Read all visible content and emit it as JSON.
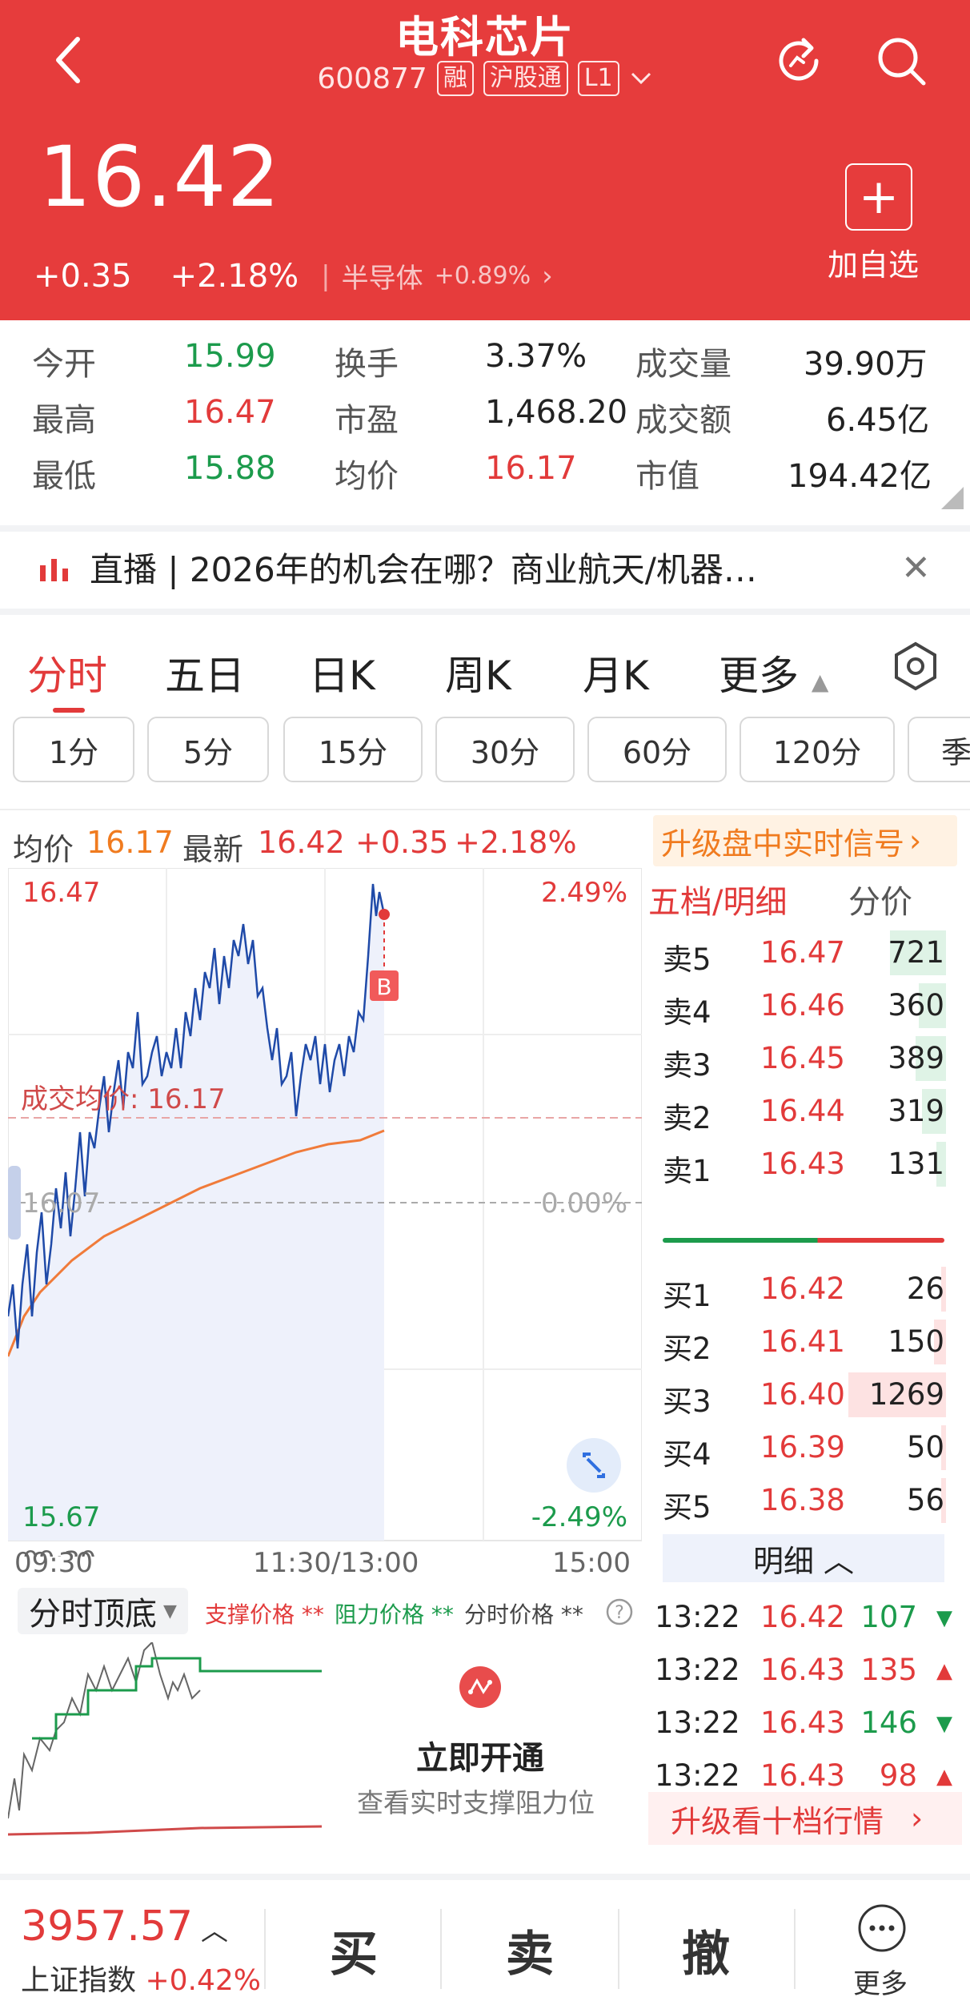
{
  "header": {
    "stock_name": "电科芯片",
    "code": "600877",
    "tags": [
      "融",
      "沪股通",
      "L1"
    ],
    "price": "16.42",
    "change": "+0.35",
    "change_pct": "+2.18%",
    "sector_name": "半导体",
    "sector_pct": "+0.89%",
    "add_label": "加自选"
  },
  "stats": {
    "today_open_label": "今开",
    "today_open": "15.99",
    "high_label": "最高",
    "high": "16.47",
    "low_label": "最低",
    "low": "15.88",
    "turnover_label": "换手",
    "turnover": "3.37%",
    "pe_label": "市盈",
    "pe": "1,468.20",
    "avg_label": "均价",
    "avg": "16.17",
    "volume_label": "成交量",
    "volume": "39.90万",
    "amount_label": "成交额",
    "amount": "6.45亿",
    "mktcap_label": "市值",
    "mktcap": "194.42亿"
  },
  "news": {
    "text": "直播 | 2026年的机会在哪？商业航天/机器…"
  },
  "tabs": [
    "分时",
    "五日",
    "日K",
    "周K",
    "月K",
    "更多"
  ],
  "periods": [
    "1分",
    "5分",
    "15分",
    "30分",
    "60分",
    "120分",
    "季"
  ],
  "infoline": {
    "avg_label": "均价",
    "avg": "16.17",
    "latest_label": "最新",
    "latest": "16.42",
    "chg": "+0.35",
    "pct": "+2.18%",
    "upgrade": "升级盘中实时信号"
  },
  "chart": {
    "y_top": "16.47",
    "y_mid": "16.07",
    "y_bottom": "15.67",
    "pct_top": "2.49%",
    "pct_mid": "0.00%",
    "pct_bottom": "-2.49%",
    "avg_line_label": "成交均价: 16.17",
    "marker": "B",
    "x_start": "09:30",
    "x_mid": "11:30/13:00",
    "x_end": "15:00",
    "colors": {
      "price": "#1f4aa8",
      "avg": "#f07b3a",
      "up": "#e23a3a",
      "down": "#1c9b4c"
    }
  },
  "book": {
    "title": "五档/明细",
    "title_right": "分价",
    "sells": [
      {
        "label": "卖5",
        "price": "16.47",
        "qty": "721",
        "frac": 0.57
      },
      {
        "label": "卖4",
        "price": "16.46",
        "qty": "360",
        "frac": 0.28
      },
      {
        "label": "卖3",
        "price": "16.45",
        "qty": "389",
        "frac": 0.31
      },
      {
        "label": "卖2",
        "price": "16.44",
        "qty": "319",
        "frac": 0.25
      },
      {
        "label": "卖1",
        "price": "16.43",
        "qty": "131",
        "frac": 0.1
      }
    ],
    "buys": [
      {
        "label": "买1",
        "price": "16.42",
        "qty": "26",
        "frac": 0.02
      },
      {
        "label": "买2",
        "price": "16.41",
        "qty": "150",
        "frac": 0.12
      },
      {
        "label": "买3",
        "price": "16.40",
        "qty": "1269",
        "frac": 1.0
      },
      {
        "label": "买4",
        "price": "16.39",
        "qty": "50",
        "frac": 0.04
      },
      {
        "label": "买5",
        "price": "16.38",
        "qty": "56",
        "frac": 0.04
      }
    ],
    "detail_label": "明细",
    "ticks": [
      {
        "time": "13:22",
        "price": "16.42",
        "vol": "107",
        "dir": "down"
      },
      {
        "time": "13:22",
        "price": "16.43",
        "vol": "135",
        "dir": "up"
      },
      {
        "time": "13:22",
        "price": "16.43",
        "vol": "146",
        "dir": "down"
      },
      {
        "time": "13:22",
        "price": "16.43",
        "vol": "98",
        "dir": "up"
      }
    ],
    "upgrade10": "升级看十档行情"
  },
  "indicator": {
    "select": "分时顶底",
    "legend_support": "支撑价格 **",
    "legend_resist": "阻力价格 **",
    "legend_time": "分时价格 **",
    "unlock_title": "立即开通",
    "unlock_sub": "查看实时支撑阻力位"
  },
  "bottom": {
    "index_value": "3957.57",
    "index_name": "上证指数",
    "index_pct": "+0.42%",
    "buy": "买",
    "sell": "卖",
    "cancel": "撤",
    "more": "更多"
  }
}
